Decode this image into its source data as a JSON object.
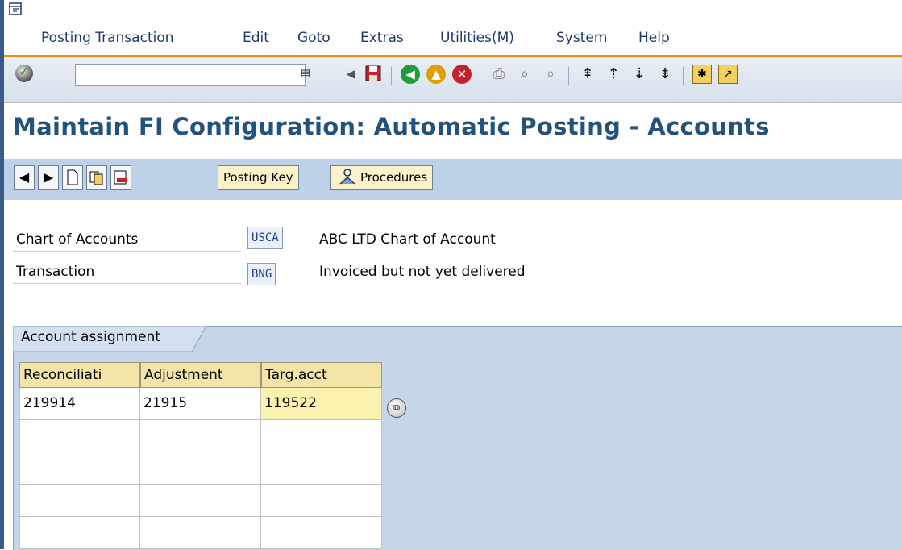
{
  "menubar": {
    "items": [
      "Posting Transaction",
      "Edit",
      "Goto",
      "Extras",
      "Utilities(M)",
      "System",
      "Help"
    ]
  },
  "toolbar": {
    "command_field_value": "",
    "icons": [
      "enter-icon",
      "command-dropdown-icon",
      "back-arrow-icon",
      "save-icon",
      "back-icon",
      "exit-icon",
      "cancel-icon",
      "print-icon",
      "find-icon",
      "find-next-icon",
      "first-page-icon",
      "previous-page-icon",
      "next-page-icon",
      "last-page-icon",
      "create-session-icon",
      "shortcut-icon"
    ]
  },
  "page": {
    "title": "Maintain FI Configuration: Automatic Posting - Accounts"
  },
  "app_toolbar": {
    "posting_key_label": "Posting Key",
    "procedures_label": "Procedures"
  },
  "header": {
    "chart_of_accounts": {
      "label": "Chart of Accounts",
      "value": "USCA",
      "description": "ABC LTD Chart of Account"
    },
    "transaction": {
      "label": "Transaction",
      "value": "BNG",
      "description": "Invoiced but not yet delivered"
    }
  },
  "tab": {
    "label": "Account assignment"
  },
  "table": {
    "columns": [
      "Reconciliati",
      "Adjustment",
      "Targ.acct"
    ],
    "rows": [
      [
        "219914",
        "21915",
        "119522"
      ],
      [
        "",
        "",
        ""
      ],
      [
        "",
        "",
        ""
      ],
      [
        "",
        "",
        ""
      ],
      [
        "",
        "",
        ""
      ]
    ]
  },
  "colors": {
    "title": "#23527c",
    "menu_accent": "#f08c10",
    "app_toolbar_bg": "#bfd1e8",
    "table_header_bg": "#f4e4a8"
  }
}
